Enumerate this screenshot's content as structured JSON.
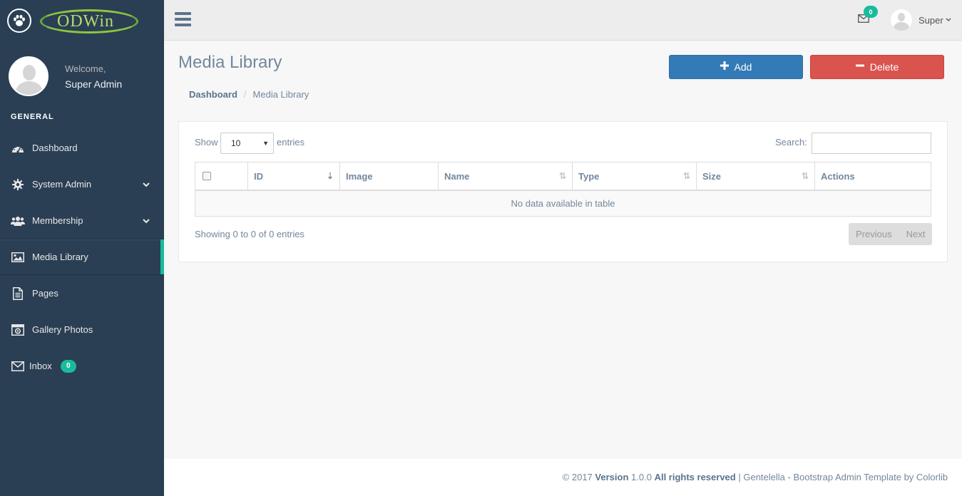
{
  "brand": {
    "logo_text": "ODWin",
    "logo_colors": [
      "#8DC63F",
      "#B7D96A"
    ]
  },
  "profile": {
    "welcome": "Welcome,",
    "name": "Super Admin"
  },
  "sidebar": {
    "section": "GENERAL",
    "items": [
      {
        "label": "Dashboard",
        "icon": "dashboard-icon"
      },
      {
        "label": "System Admin",
        "icon": "gear-icon",
        "has_children": true
      },
      {
        "label": "Membership",
        "icon": "users-icon",
        "has_children": true
      },
      {
        "label": "Media Library",
        "icon": "image-icon",
        "active": true
      },
      {
        "label": "Pages",
        "icon": "file-icon"
      },
      {
        "label": "Gallery Photos",
        "icon": "camera-icon"
      },
      {
        "label": "Inbox",
        "icon": "envelope-icon",
        "badge": "0"
      }
    ]
  },
  "topnav": {
    "mail_badge": "0",
    "user_name": "Super"
  },
  "page": {
    "title": "Media Library",
    "add_label": "Add",
    "delete_label": "Delete"
  },
  "breadcrumb": {
    "home": "Dashboard",
    "current": "Media Library"
  },
  "table": {
    "show_label": "Show",
    "page_size": "10",
    "entries_label": "entries",
    "search_label": "Search:",
    "columns": [
      "ID",
      "Image",
      "Name",
      "Type",
      "Size",
      "Actions"
    ],
    "empty_message": "No data available in table",
    "info": "Showing 0 to 0 of 0 entries",
    "prev_label": "Previous",
    "next_label": "Next"
  },
  "footer": {
    "copyright": "© 2017",
    "version_label": "Version",
    "version": "1.0.0",
    "rights": "All rights reserved",
    "separator": "|",
    "credit": "Gentelella - Bootstrap Admin Template by Colorlib"
  },
  "colors": {
    "sidebar": "#2A3F54",
    "accent": "#1ABB9C",
    "primary": "#337AB7",
    "danger": "#D9534F"
  }
}
